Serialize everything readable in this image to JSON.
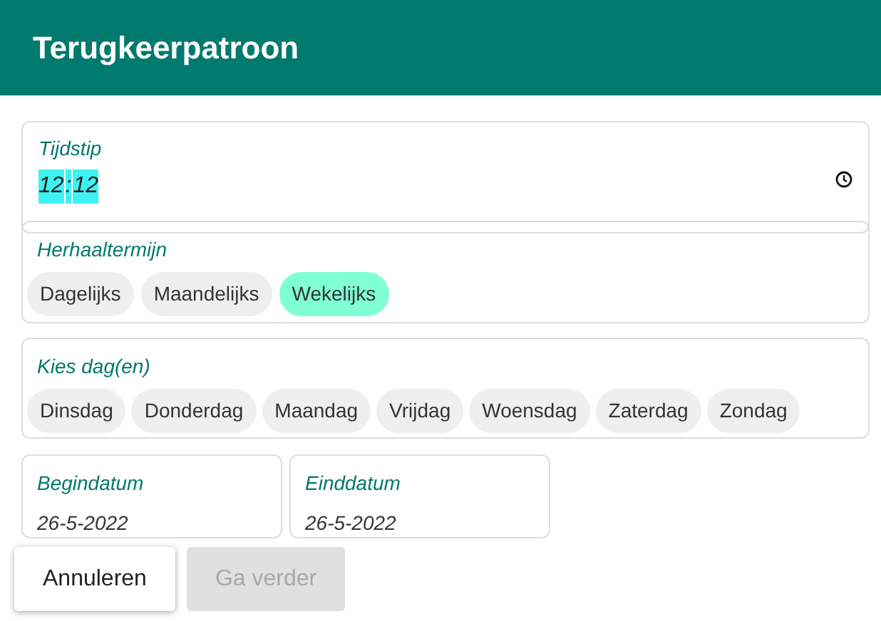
{
  "dialog": {
    "title": "Terugkeerpatroon"
  },
  "time_field": {
    "label": "Tijdstip",
    "hours": "12",
    "separator": ":",
    "minutes": "12",
    "highlighted": true
  },
  "repeat": {
    "label": "Herhaaltermijn",
    "options": [
      {
        "label": "Dagelijks",
        "selected": false
      },
      {
        "label": "Maandelijks",
        "selected": false
      },
      {
        "label": "Wekelijks",
        "selected": true
      }
    ]
  },
  "days": {
    "label": "Kies dag(en)",
    "options": [
      {
        "label": "Dinsdag",
        "selected": false
      },
      {
        "label": "Donderdag",
        "selected": false
      },
      {
        "label": "Maandag",
        "selected": false
      },
      {
        "label": "Vrijdag",
        "selected": false
      },
      {
        "label": "Woensdag",
        "selected": false
      },
      {
        "label": "Zaterdag",
        "selected": false
      },
      {
        "label": "Zondag",
        "selected": false
      }
    ]
  },
  "dates": [
    {
      "label": "Begindatum",
      "value": "26-5-2022"
    },
    {
      "label": "Einddatum",
      "value": "26-5-2022"
    }
  ],
  "buttons": [
    {
      "label": "Annuleren",
      "disabled": false
    },
    {
      "label": "Ga verder",
      "disabled": true
    }
  ]
}
